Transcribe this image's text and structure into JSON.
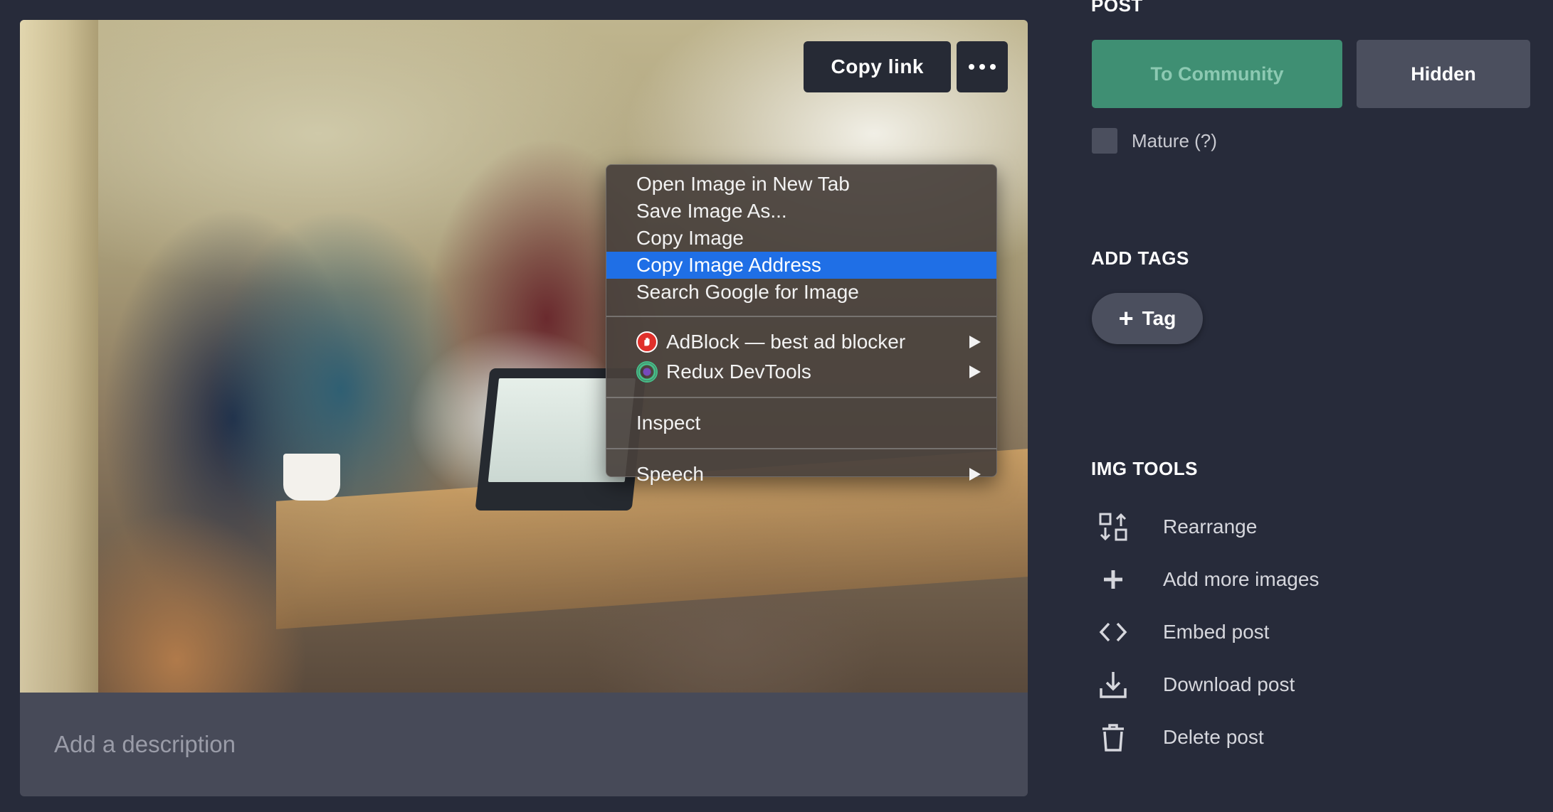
{
  "image": {
    "copy_link_label": "Copy link",
    "more_icon": "ellipsis-icon"
  },
  "description": {
    "placeholder": "Add a description"
  },
  "context_menu": {
    "items": [
      {
        "label": "Open Image in New Tab"
      },
      {
        "label": "Save Image As..."
      },
      {
        "label": "Copy Image"
      },
      {
        "label": "Copy Image Address",
        "highlighted": true
      },
      {
        "label": "Search Google for Image"
      }
    ],
    "extensions": [
      {
        "label": "AdBlock — best ad blocker",
        "icon": "adblock-icon",
        "submenu": true
      },
      {
        "label": "Redux DevTools",
        "icon": "redux-devtools-icon",
        "submenu": true
      }
    ],
    "inspect_label": "Inspect",
    "speech_label": "Speech",
    "highlight_color": "#1f6fe6"
  },
  "sidebar": {
    "post_heading": "POST",
    "community_button": "To Community",
    "hidden_button": "Hidden",
    "mature_label": "Mature (?)",
    "add_tags_heading": "ADD TAGS",
    "tag_button": "Tag",
    "img_tools_heading": "IMG TOOLS",
    "tools": [
      {
        "label": "Rearrange",
        "icon": "rearrange-icon"
      },
      {
        "label": "Add more images",
        "icon": "plus-icon"
      },
      {
        "label": "Embed post",
        "icon": "code-brackets-icon"
      },
      {
        "label": "Download post",
        "icon": "download-icon"
      },
      {
        "label": "Delete post",
        "icon": "trash-icon"
      }
    ]
  },
  "colors": {
    "background": "#272b3a",
    "community_green": "#3f8f73",
    "button_gray": "#4b4f5e"
  }
}
